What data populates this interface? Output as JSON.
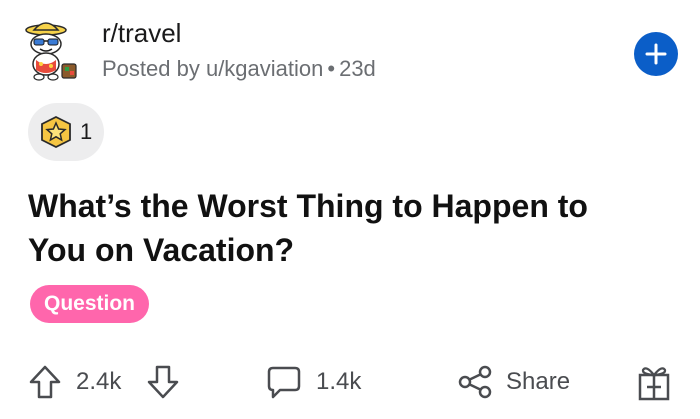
{
  "header": {
    "subreddit": "r/travel",
    "posted_by": "Posted by u/kgaviation",
    "separator": "•",
    "age": "23d"
  },
  "awards": {
    "count": "1"
  },
  "post": {
    "title_line1": "What’s the Worst Thing to Happen to",
    "title_line2": "You on Vacation?",
    "flair": "Question"
  },
  "actions": {
    "upvotes": "2.4k",
    "comments": "1.4k",
    "share": "Share"
  },
  "colors": {
    "join_button": "#0b5ec8",
    "flair_bg": "#ff66ac",
    "award_pill_bg": "#ededee",
    "meta_text": "#6b6e72"
  },
  "icons": {
    "avatar": "snoo-avatar-icon",
    "join": "plus-icon",
    "award": "award-badge-icon",
    "upvote": "arrow-up-icon",
    "downvote": "arrow-down-icon",
    "comment": "comment-bubble-icon",
    "share": "share-icon",
    "gift": "gift-award-icon"
  }
}
